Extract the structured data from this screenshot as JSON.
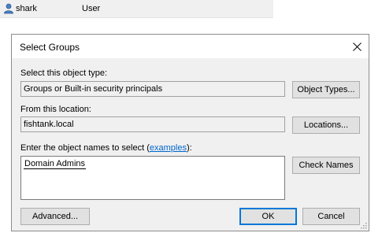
{
  "background_list": {
    "rows": [
      {
        "name": "shark",
        "type": "User",
        "icon": "user-icon"
      }
    ]
  },
  "dialog": {
    "title": "Select Groups",
    "object_type_label": "Select this object type:",
    "object_type_value": "Groups or Built-in security principals",
    "object_types_button": "Object Types...",
    "location_label": "From this location:",
    "location_value": "fishtank.local",
    "locations_button": "Locations...",
    "enter_label_prefix": "Enter the object names to select (",
    "enter_label_link": "examples",
    "enter_label_suffix": "):",
    "entered_names": "Domain Admins",
    "check_names_button": "Check Names",
    "advanced_button": "Advanced...",
    "ok_button": "OK",
    "cancel_button": "Cancel"
  },
  "colors": {
    "dialog_bg": "#f0f0f0",
    "link": "#0066cc",
    "default_button_border": "#0078d7"
  }
}
